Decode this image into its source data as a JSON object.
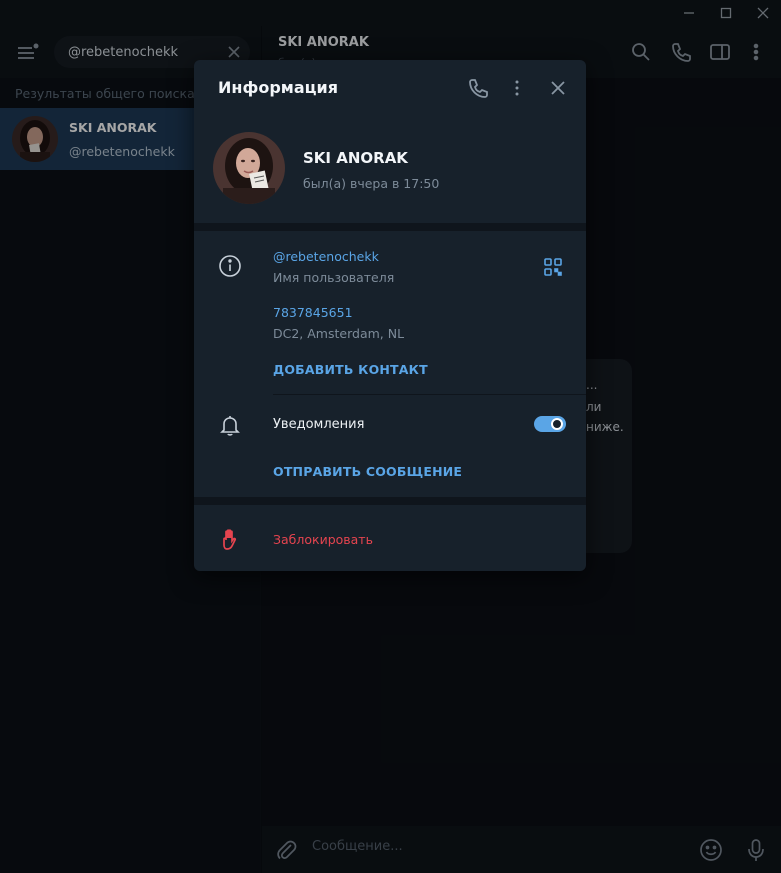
{
  "window": {
    "controls": [
      "minimize-icon",
      "maximize-icon",
      "close-icon"
    ]
  },
  "sidebar": {
    "search_value": "@rebetenochekk",
    "results_label": "Результаты общего поиска",
    "result": {
      "name": "SKI ANORAK",
      "username": "@rebetenochekk"
    }
  },
  "chat": {
    "title": "SKI ANORAK",
    "subtitle": "был(а) вчера",
    "bubble_lines": [
      "...",
      "ли",
      "ниже."
    ],
    "message_placeholder": "Сообщение..."
  },
  "popup": {
    "title": "Информация",
    "name": "SKI ANORAK",
    "status": "был(а) вчера в 17:50",
    "username": "@rebetenochekk",
    "username_label": "Имя пользователя",
    "id": "7837845651",
    "dc": "DC2, Amsterdam, NL",
    "add_contact": "ДОБАВИТЬ КОНТАКТ",
    "notifications_label": "Уведомления",
    "notifications_on": true,
    "send_message": "ОТПРАВИТЬ СООБЩЕНИЕ",
    "block": "Заблокировать"
  },
  "colors": {
    "accent": "#5aa5e6",
    "danger": "#e5444f",
    "popup_bg": "#17212b",
    "selected_item": "#1e3a56"
  }
}
